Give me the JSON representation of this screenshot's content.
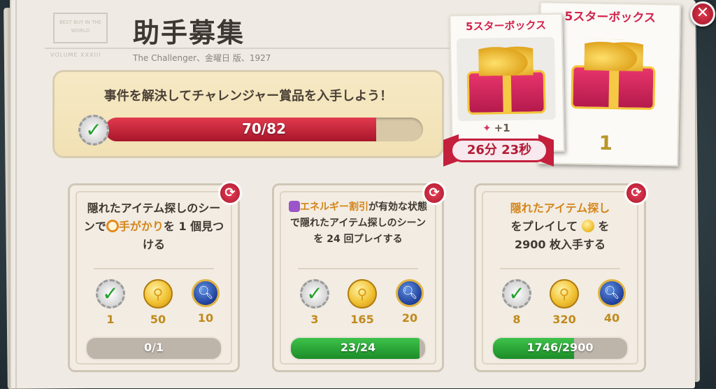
{
  "page": {
    "title": "助手募集",
    "subtitle": "The Challenger、金曜日 版、1927",
    "masthead_stamp": "BEST BUY IN THE WORLD",
    "masthead_sub": "VOLUME XXXIII"
  },
  "banner": {
    "text": "事件を解決してチャレンジャー賞品を入手しよう！",
    "progress_text": "70/82",
    "progress_current": 70,
    "progress_total": 82
  },
  "reward_cards": [
    {
      "title": "5スターボックス",
      "plus": "+1",
      "timer": "26分 23秒"
    },
    {
      "title": "5スターボックス",
      "count": "1"
    }
  ],
  "tasks": [
    {
      "text_parts": [
        "隠れたアイテム探しのシーンで",
        "手がかり",
        "を 1 個見つける"
      ],
      "rewards": {
        "xp": "1",
        "coins": "50",
        "medals": "10"
      },
      "progress_text": "0/1",
      "progress_current": 0,
      "progress_total": 1
    },
    {
      "text_parts": [
        "エネルギー割引",
        "が有効な状態で隠れたアイテム探しのシーンを 24 回プレイする"
      ],
      "rewards": {
        "xp": "3",
        "coins": "165",
        "medals": "20"
      },
      "progress_text": "23/24",
      "progress_current": 23,
      "progress_total": 24
    },
    {
      "text_parts": [
        "隠れたアイテム探し",
        "をプレイして",
        "を",
        "2900 枚入手する"
      ],
      "rewards": {
        "xp": "8",
        "coins": "320",
        "medals": "40"
      },
      "progress_text": "1746/2900",
      "progress_current": 1746,
      "progress_total": 2900
    }
  ],
  "icons": {
    "close": "close-icon",
    "refresh": "refresh-icon",
    "check": "checkmark-badge-icon",
    "coin": "gold-coin-icon",
    "medal": "magnifier-medal-icon",
    "gift": "gift-box-icon",
    "star": "star-icon"
  },
  "colors": {
    "accent_red": "#c41f3c",
    "progress_red": "#e23a4e",
    "progress_green": "#2faa3a",
    "highlight_orange": "#d4861c",
    "gold": "#c08a1e"
  }
}
